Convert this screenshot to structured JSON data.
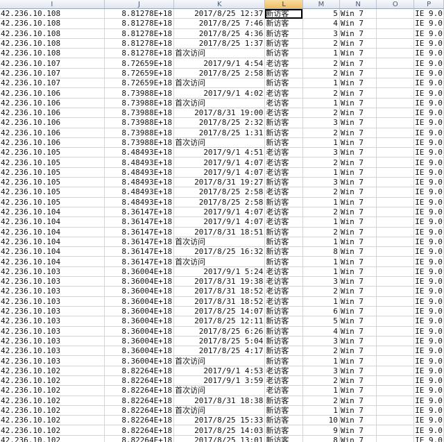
{
  "columns": [
    "I",
    "J",
    "K",
    "L",
    "M",
    "N",
    "O",
    "P"
  ],
  "selected_column": "L",
  "rows": [
    [
      "42.236.10.108",
      "8.81278E+18",
      "2017/8/25 12:37",
      "新访客",
      "5",
      "Win 7",
      "",
      "IE 9.0"
    ],
    [
      "42.236.10.108",
      "8.81278E+18",
      "2017/8/25 7:46",
      "新访客",
      "4",
      "Win 7",
      "",
      "IE 9.0"
    ],
    [
      "42.236.10.108",
      "8.81278E+18",
      "2017/8/25 4:36",
      "新访客",
      "3",
      "Win 7",
      "",
      "IE 9.0"
    ],
    [
      "42.236.10.108",
      "8.81278E+18",
      "2017/8/25 1:37",
      "新访客",
      "2",
      "Win 7",
      "",
      "IE 9.0"
    ],
    [
      "42.236.10.108",
      "8.81278E+18",
      "首次访问",
      "新访客",
      "1",
      "Win 7",
      "",
      "IE 9.0"
    ],
    [
      "42.236.10.107",
      "8.72659E+18",
      "2017/9/1 4:54",
      "老访客",
      "2",
      "Win 7",
      "",
      "IE 9.0"
    ],
    [
      "42.236.10.107",
      "8.72659E+18",
      "2017/8/25 2:58",
      "新访客",
      "2",
      "Win 7",
      "",
      "IE 9.0"
    ],
    [
      "42.236.10.107",
      "8.72659E+18",
      "首次访问",
      "新访客",
      "1",
      "Win 7",
      "",
      "IE 9.0"
    ],
    [
      "42.236.10.106",
      "8.73988E+18",
      "2017/9/1 4:02",
      "老访客",
      "2",
      "Win 7",
      "",
      "IE 9.0"
    ],
    [
      "42.236.10.106",
      "8.73988E+18",
      "首次访问",
      "老访客",
      "1",
      "Win 7",
      "",
      "IE 9.0"
    ],
    [
      "42.236.10.106",
      "8.73988E+18",
      "2017/8/31 19:00",
      "老访客",
      "2",
      "Win 7",
      "",
      "IE 9.0"
    ],
    [
      "42.236.10.106",
      "8.73988E+18",
      "2017/8/25 2:32",
      "新访客",
      "3",
      "Win 7",
      "",
      "IE 9.0"
    ],
    [
      "42.236.10.106",
      "8.73988E+18",
      "2017/8/25 1:31",
      "新访客",
      "2",
      "Win 7",
      "",
      "IE 9.0"
    ],
    [
      "42.236.10.106",
      "8.73988E+18",
      "首次访问",
      "新访客",
      "1",
      "Win 7",
      "",
      "IE 9.0"
    ],
    [
      "42.236.10.105",
      "8.48493E+18",
      "2017/9/1 4:51",
      "老访客",
      "3",
      "Win 7",
      "",
      "IE 9.0"
    ],
    [
      "42.236.10.105",
      "8.48493E+18",
      "2017/9/1 4:07",
      "老访客",
      "2",
      "Win 7",
      "",
      "IE 9.0"
    ],
    [
      "42.236.10.105",
      "8.48493E+18",
      "2017/9/1 4:07",
      "老访客",
      "1",
      "Win 7",
      "",
      "IE 9.0"
    ],
    [
      "42.236.10.105",
      "8.48493E+18",
      "2017/8/31 19:27",
      "新访客",
      "3",
      "Win 7",
      "",
      "IE 9.0"
    ],
    [
      "42.236.10.105",
      "8.48493E+18",
      "2017/8/25 2:58",
      "老访客",
      "2",
      "Win 7",
      "",
      "IE 9.0"
    ],
    [
      "42.236.10.105",
      "8.48493E+18",
      "2017/8/25 2:58",
      "新访客",
      "1",
      "Win 7",
      "",
      "IE 9.0"
    ],
    [
      "42.236.10.104",
      "8.36147E+18",
      "2017/9/1 4:07",
      "老访客",
      "2",
      "Win 7",
      "",
      "IE 9.0"
    ],
    [
      "42.236.10.104",
      "8.36147E+18",
      "2017/9/1 4:07",
      "老访客",
      "1",
      "Win 7",
      "",
      "IE 9.0"
    ],
    [
      "42.236.10.104",
      "8.36147E+18",
      "2017/8/31 18:51",
      "新访客",
      "2",
      "Win 7",
      "",
      "IE 9.0"
    ],
    [
      "42.236.10.104",
      "8.36147E+18",
      "首次访问",
      "新访客",
      "1",
      "Win 7",
      "",
      "IE 9.0"
    ],
    [
      "42.236.10.104",
      "8.36147E+18",
      "2017/8/25 16:32",
      "新访客",
      "8",
      "Win 7",
      "",
      "IE 9.0"
    ],
    [
      "42.236.10.104",
      "8.36147E+18",
      "首次访问",
      "新访客",
      "1",
      "Win 7",
      "",
      "IE 9.0"
    ],
    [
      "42.236.10.103",
      "8.36004E+18",
      "2017/9/1 5:24",
      "老访客",
      "1",
      "Win 7",
      "",
      "IE 9.0"
    ],
    [
      "42.236.10.103",
      "8.36004E+18",
      "2017/8/31 19:38",
      "老访客",
      "3",
      "Win 7",
      "",
      "IE 9.0"
    ],
    [
      "42.236.10.103",
      "8.36004E+18",
      "2017/8/31 18:52",
      "老访客",
      "2",
      "Win 7",
      "",
      "IE 9.0"
    ],
    [
      "42.236.10.103",
      "8.36004E+18",
      "2017/8/31 18:52",
      "老访客",
      "1",
      "Win 7",
      "",
      "IE 9.0"
    ],
    [
      "42.236.10.103",
      "8.36004E+18",
      "2017/8/25 14:07",
      "新访客",
      "6",
      "Win 7",
      "",
      "IE 9.0"
    ],
    [
      "42.236.10.103",
      "8.36004E+18",
      "2017/8/25 12:11",
      "新访客",
      "5",
      "Win 7",
      "",
      "IE 9.0"
    ],
    [
      "42.236.10.103",
      "8.36004E+18",
      "2017/8/25 6:26",
      "新访客",
      "4",
      "Win 7",
      "",
      "IE 9.0"
    ],
    [
      "42.236.10.103",
      "8.36004E+18",
      "2017/8/25 5:04",
      "新访客",
      "3",
      "Win 7",
      "",
      "IE 9.0"
    ],
    [
      "42.236.10.103",
      "8.36004E+18",
      "2017/8/25 4:17",
      "新访客",
      "2",
      "Win 7",
      "",
      "IE 9.0"
    ],
    [
      "42.236.10.103",
      "8.36004E+18",
      "首次访问",
      "新访客",
      "1",
      "Win 7",
      "",
      "IE 9.0"
    ],
    [
      "42.236.10.102",
      "8.82264E+18",
      "2017/9/1 4:53",
      "老访客",
      "3",
      "Win 7",
      "",
      "IE 9.0"
    ],
    [
      "42.236.10.102",
      "8.82264E+18",
      "2017/9/1 3:59",
      "老访客",
      "2",
      "Win 7",
      "",
      "IE 9.0"
    ],
    [
      "42.236.10.102",
      "8.82264E+18",
      "首次访问",
      "老访客",
      "1",
      "Win 7",
      "",
      "IE 9.0"
    ],
    [
      "42.236.10.102",
      "8.82264E+18",
      "2017/8/31 18:38",
      "新访客",
      "2",
      "Win 7",
      "",
      "IE 9.0"
    ],
    [
      "42.236.10.102",
      "8.82264E+18",
      "首次访问",
      "新访客",
      "1",
      "Win 7",
      "",
      "IE 9.0"
    ],
    [
      "42.236.10.102",
      "8.82264E+18",
      "2017/8/25 15:33",
      "新访客",
      "10",
      "Win 7",
      "",
      "IE 9.0"
    ],
    [
      "42.236.10.102",
      "8.82264E+18",
      "2017/8/25 14:03",
      "新访客",
      "9",
      "Win 7",
      "",
      "IE 9.0"
    ],
    [
      "42.236.10.102",
      "8.82264E+18",
      "2017/8/25 13:01",
      "新访客",
      "8",
      "Win 7",
      "",
      "IE 9.0"
    ]
  ]
}
